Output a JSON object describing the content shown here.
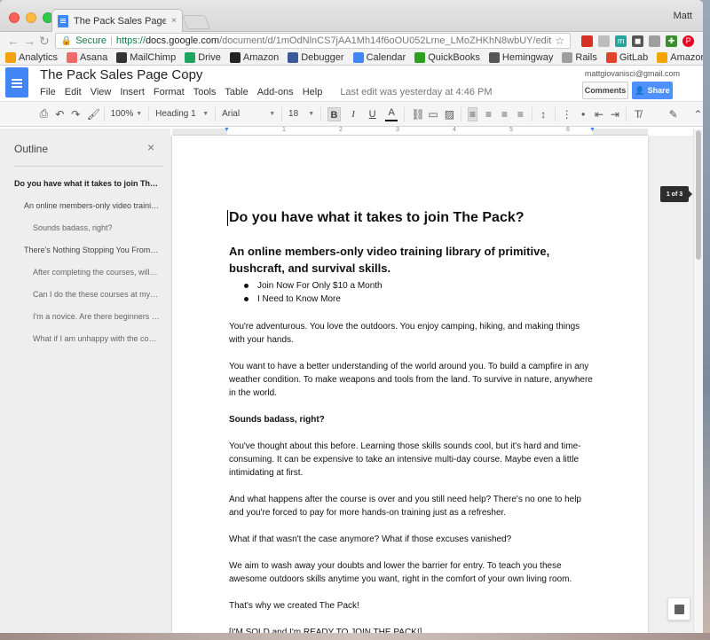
{
  "browser": {
    "tab_title": "The Pack Sales Page Copy - G",
    "tab_close": "×",
    "user": "Matt",
    "omnibox": {
      "secure": "Secure",
      "separator": "|",
      "url_scheme": "https://",
      "url_host": "docs.google.com",
      "url_path": "/document/d/1mOdNlnCS7jAA1Mh14f6oOU052Lrne_LMoZHKhN8wbUY/edit"
    },
    "extension_icons": [
      "m",
      "◼",
      "✚",
      "P"
    ],
    "bookmarks": [
      {
        "label": "Analytics",
        "icon": "analytics-icon",
        "color": "#f4a10a"
      },
      {
        "label": "Asana",
        "icon": "asana-icon",
        "color": "#f06a6a"
      },
      {
        "label": "MailChimp",
        "icon": "mailchimp-icon",
        "color": "#333333"
      },
      {
        "label": "Drive",
        "icon": "drive-icon",
        "color": "#1fa463"
      },
      {
        "label": "Amazon",
        "icon": "amazon-icon",
        "color": "#222222"
      },
      {
        "label": "Debugger",
        "icon": "facebook-icon",
        "color": "#3b5998"
      },
      {
        "label": "Calendar",
        "icon": "calendar-icon",
        "color": "#4285f4"
      },
      {
        "label": "QuickBooks",
        "icon": "quickbooks-icon",
        "color": "#2ca01c"
      },
      {
        "label": "Hemingway",
        "icon": "hemingway-icon",
        "color": "#555555"
      },
      {
        "label": "Rails",
        "icon": "folder-icon",
        "color": "#9e9e9e"
      },
      {
        "label": "GitLab",
        "icon": "gitlab-icon",
        "color": "#e24329"
      },
      {
        "label": "AmazonSmile",
        "icon": "amazonsmile-icon",
        "color": "#f0a500"
      }
    ]
  },
  "docs": {
    "title": "The Pack Sales Page Copy",
    "menus": [
      "File",
      "Edit",
      "View",
      "Insert",
      "Format",
      "Tools",
      "Table",
      "Add-ons",
      "Help"
    ],
    "last_edit": "Last edit was yesterday at 4:46 PM",
    "account": "mattgiovanisci@gmail.com",
    "comments_label": "Comments",
    "share_label": "Share",
    "toolbar": {
      "zoom": "100%",
      "style": "Heading 1",
      "font": "Arial",
      "size": "18",
      "bold": "B",
      "italic": "I",
      "underline": "U",
      "text_color": "A"
    },
    "ruler_numbers": [
      "1",
      "1",
      "2",
      "3",
      "4",
      "5",
      "6"
    ],
    "page_indicator": "1 of 3"
  },
  "outline": {
    "title": "Outline",
    "close": "×",
    "items": [
      {
        "text": "Do you have what it takes to join The ...",
        "level": 1
      },
      {
        "text": "An online members-only video training...",
        "level": 2
      },
      {
        "text": "Sounds badass, right?",
        "level": 3
      },
      {
        "text": "There's Nothing Stopping You From E...",
        "level": 2
      },
      {
        "text": "After completing the courses, will I ...",
        "level": 3
      },
      {
        "text": "Can I do the these courses at my o...",
        "level": 3
      },
      {
        "text": "I'm a novice. Are there beginners c...",
        "level": 3
      },
      {
        "text": "What if I am unhappy with the cour...",
        "level": 3
      }
    ]
  },
  "document": {
    "heading1": "Do you have what it takes to join The Pack?",
    "heading2": "An online members-only video training library of primitive, bushcraft, and survival skills.",
    "bullets": [
      "Join Now For Only $10 a Month",
      "I Need to Know More"
    ],
    "p1": "You're adventurous. You love the outdoors. You enjoy camping, hiking, and making things with your hands.",
    "p2": "You want to have a better understanding of the world around you. To build a campfire in any weather condition. To make weapons and tools from the land. To survive in nature, anywhere in the world.",
    "p3": "Sounds badass, right?",
    "p4": "You've thought about this before. Learning those skills sounds cool, but it's hard and time-consuming. It can be expensive to take an intensive multi-day course. Maybe even a little intimidating at first.",
    "p5": "And what happens after the course is over and you still need help? There's no one to help and you're forced to pay for more hands-on training just as a refresher.",
    "p6": "What if that wasn't the case anymore? What if those excuses vanished?",
    "p7": "We aim to wash away your doubts and lower the barrier for entry. To teach you these awesome outdoors skills anytime you want, right in the comfort of your own living room.",
    "p8": "That's why we created The Pack!",
    "p9": "[I'M SOLD and I'm READY TO JOIN THE PACK!]"
  }
}
